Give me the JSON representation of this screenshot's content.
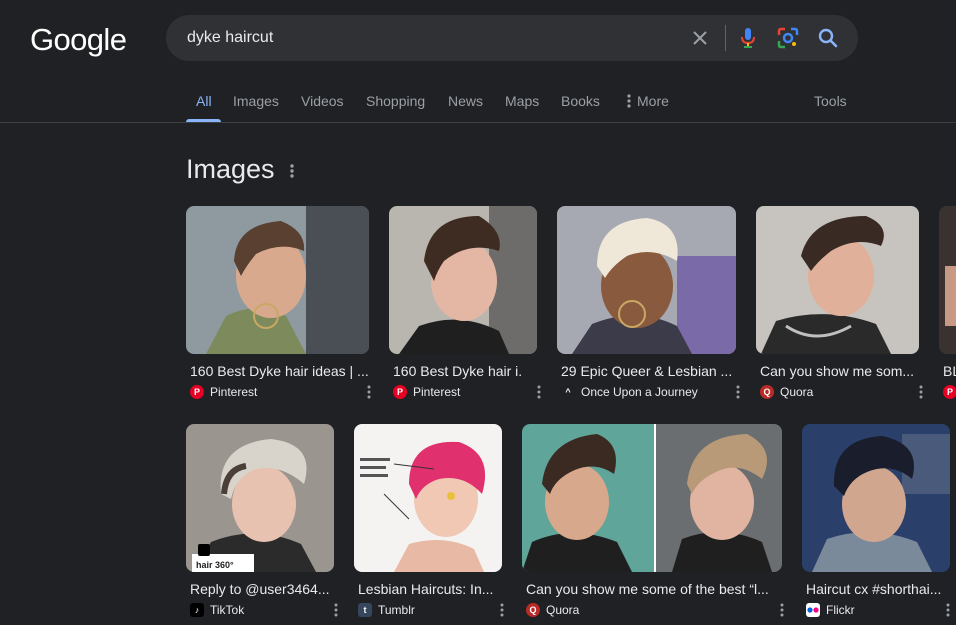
{
  "logo": "Google",
  "search": {
    "query": "dyke haircut"
  },
  "tabs": [
    {
      "label": "All",
      "active": true
    },
    {
      "label": "Images"
    },
    {
      "label": "Videos"
    },
    {
      "label": "Shopping"
    },
    {
      "label": "News"
    },
    {
      "label": "Maps"
    },
    {
      "label": "Books"
    },
    {
      "label": "More"
    }
  ],
  "tools_label": "Tools",
  "section": {
    "title": "Images"
  },
  "results": [
    {
      "title": "160 Best Dyke hair ideas | ...",
      "source": "Pinterest",
      "favicon": "pinterest-icon"
    },
    {
      "title": "160 Best Dyke hair i...",
      "source": "Pinterest",
      "favicon": "pinterest-icon"
    },
    {
      "title": "29 Epic Queer & Lesbian ...",
      "source": "Once Upon a Journey",
      "favicon": "journey-icon"
    },
    {
      "title": "Can you show me som...",
      "source": "Quora",
      "favicon": "quora-icon"
    },
    {
      "title": "BL",
      "source": "",
      "favicon": "pinterest-icon"
    },
    {
      "title": "Reply to @user3464...",
      "source": "TikTok",
      "favicon": "tiktok-icon",
      "overlay": "hair 360°"
    },
    {
      "title": "Lesbian Haircuts: In...",
      "source": "Tumblr",
      "favicon": "tumblr-icon"
    },
    {
      "title": "Can you show me some of the best “l...",
      "source": "Quora",
      "favicon": "quora-icon"
    },
    {
      "title": "Haircut cx #shorthai...",
      "source": "Flickr",
      "favicon": "flickr-icon"
    }
  ],
  "colors": {
    "background": "#202124",
    "search_bg": "#303134",
    "accent": "#8ab4f8",
    "muted": "#9aa0a6",
    "pinterest": "#e60023",
    "quora": "#b92b27"
  }
}
